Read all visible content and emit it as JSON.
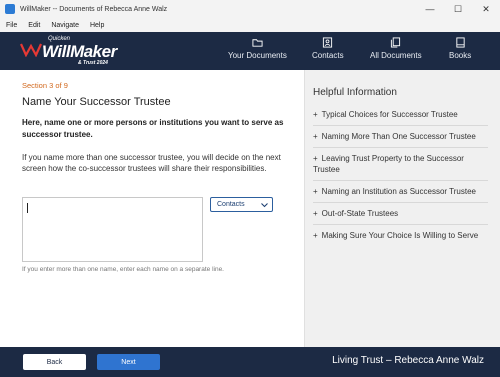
{
  "window": {
    "title": "WillMaker -- Documents of Rebecca Anne Walz",
    "minimize_glyph": "—",
    "maximize_glyph": "☐",
    "close_glyph": "✕"
  },
  "menu": [
    "File",
    "Edit",
    "Navigate",
    "Help"
  ],
  "logo": {
    "brand": "Quicken",
    "name": "WillMaker",
    "sub": "& Trust 2024"
  },
  "nav": [
    {
      "label": "Your Documents",
      "icon": "folder-icon"
    },
    {
      "label": "Contacts",
      "icon": "contact-card-icon"
    },
    {
      "label": "All Documents",
      "icon": "documents-icon"
    },
    {
      "label": "Books",
      "icon": "book-icon"
    }
  ],
  "main": {
    "section_label": "Section 3 of 9",
    "title": "Name Your Successor Trustee",
    "instruction": "Here, name one or more persons or institutions you want to serve as successor trustee.",
    "explanation": "If you name more than one successor trustee, you will decide on the next screen how the co-successor trustees will share their responsibilities.",
    "names_value": "",
    "contacts_label": "Contacts",
    "hint": "If you enter more than one name, enter each name on a separate line."
  },
  "sidebar": {
    "title": "Helpful Information",
    "items": [
      "Typical Choices for Successor Trustee",
      "Naming More Than One Successor Trustee",
      "Leaving Trust Property to the Successor Trustee",
      "Naming an Institution as Successor Trustee",
      "Out-of-State Trustees",
      "Making Sure Your Choice Is Willing to Serve"
    ]
  },
  "footer": {
    "back_label": "Back",
    "next_label": "Next",
    "document_title": "Living Trust – Rebecca Anne Walz"
  },
  "colors": {
    "header_bg": "#1c2a44",
    "accent_orange": "#d2691e",
    "next_button": "#2f74d0",
    "sidebar_bg": "#f0f0f0"
  }
}
